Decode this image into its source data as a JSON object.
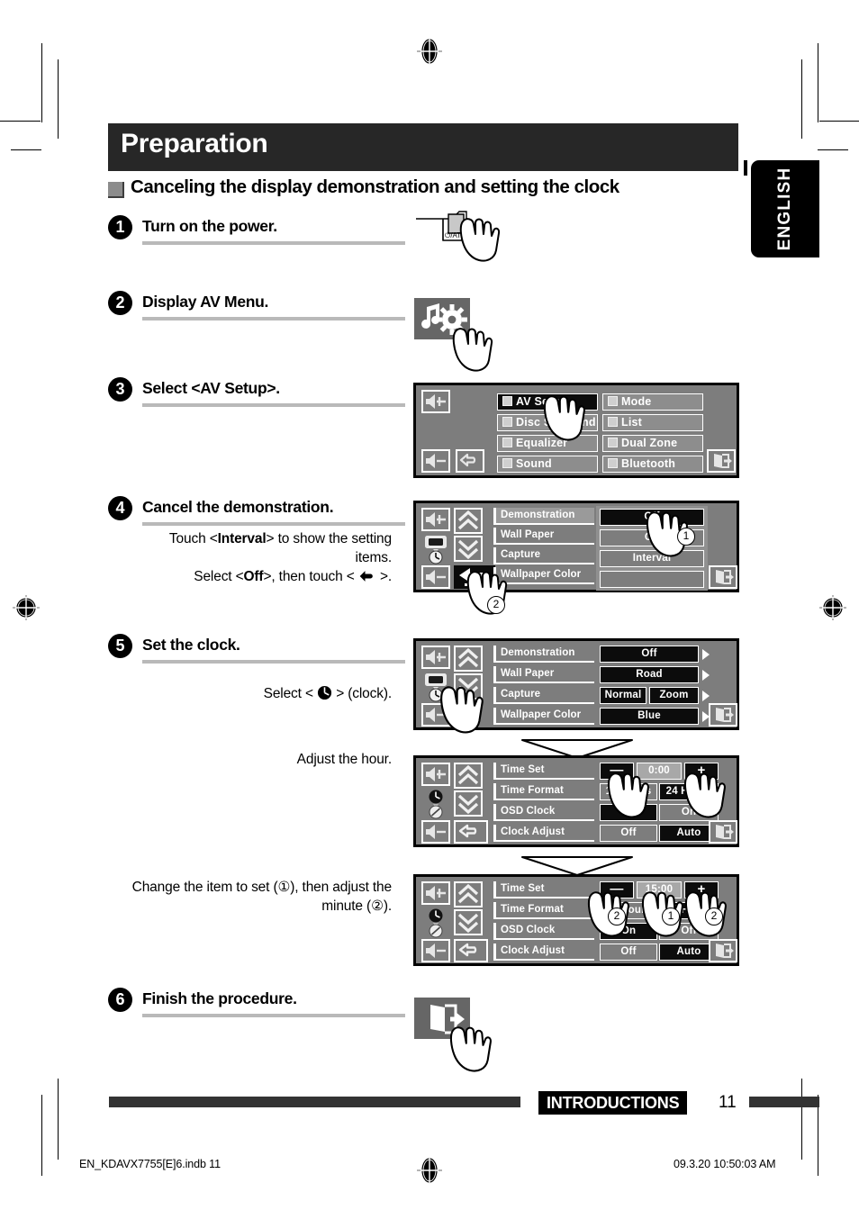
{
  "page": {
    "title": "Preparation",
    "section_heading": "Canceling the display demonstration and setting the clock",
    "language_tab": "ENGLISH",
    "footer_tag": "INTRODUCTIONS",
    "footer_page": "11",
    "colophon_left": "EN_KDAVX7755[E]6.indb   11",
    "colophon_right": "09.3.20   10:50:03 AM"
  },
  "steps": [
    {
      "num": "1",
      "title": "Turn on the power.",
      "sub": []
    },
    {
      "num": "2",
      "title": "Display AV Menu.",
      "sub": []
    },
    {
      "num": "3",
      "title": "Select <AV Setup>.",
      "sub": []
    },
    {
      "num": "4",
      "title": "Cancel the demonstration.",
      "sub": []
    },
    {
      "num": "5",
      "title": "Set the clock.",
      "sub": []
    },
    {
      "num": "6",
      "title": "Finish the procedure.",
      "sub": []
    }
  ],
  "instructions": {
    "step4_line1_pre": "Touch <",
    "step4_line1_bold": "Interval",
    "step4_line1_post": "> to show the setting",
    "step4_line2": "items.",
    "step4_line3_pre": "Select <",
    "step4_line3_bold": "Off",
    "step4_line3_post": ">, then touch < ",
    "step4_line3_end": " >.",
    "step5_select_pre": "Select < ",
    "step5_select_post": " > (clock).",
    "step5_adjust_hour": "Adjust the hour.",
    "step5_minute_line1": "Change the item to set (①), then adjust the",
    "step5_minute_line2": "minute (②)."
  },
  "av_setup_screen": {
    "left_column": [
      {
        "icon": "volume-up-icon"
      },
      {
        "icon": "back-arrow-icon"
      },
      {
        "icon": "volume-down-icon"
      }
    ],
    "menu_left": [
      {
        "label": "AV Setup",
        "icon": "av-setup-icon",
        "selected": true
      },
      {
        "label": "Disc Surround",
        "icon": "disc-surround-icon",
        "selected": false
      },
      {
        "label": "Equalizer",
        "icon": "equalizer-icon",
        "selected": false
      },
      {
        "label": "Sound",
        "icon": "sound-icon",
        "selected": false
      }
    ],
    "menu_right": [
      {
        "label": "Mode",
        "icon": "mode-icon",
        "selected": false
      },
      {
        "label": "List",
        "icon": "list-icon",
        "selected": false
      },
      {
        "label": "Dual Zone",
        "icon": "dual-zone-icon",
        "selected": false
      },
      {
        "label": "Bluetooth",
        "icon": "bluetooth-icon",
        "selected": false
      }
    ],
    "exit_icon": "exit-icon"
  },
  "demo_screen": {
    "rows": [
      {
        "label": "Demonstration",
        "value": "Off",
        "selected": true
      },
      {
        "label": "Wall Paper",
        "value": "On",
        "selected": false
      },
      {
        "label": "Capture",
        "value": "Interval",
        "selected": false
      },
      {
        "label": "Wallpaper Color",
        "value": "",
        "selected": false
      }
    ],
    "callouts": [
      "1",
      "2"
    ],
    "exit_icon": "exit-icon"
  },
  "display_screen": {
    "rows": [
      {
        "label": "Demonstration",
        "values": [
          "Off"
        ],
        "selected_index": -1
      },
      {
        "label": "Wall Paper",
        "values": [
          "Road"
        ],
        "selected_index": -1
      },
      {
        "label": "Capture",
        "values": [
          "Normal",
          "Zoom"
        ],
        "selected_index": -1
      },
      {
        "label": "Wallpaper Color",
        "values": [
          "Blue"
        ],
        "selected_index": -1
      }
    ],
    "exit_icon": "exit-icon"
  },
  "time_screen_hour": {
    "rows": [
      {
        "label": "Time Set",
        "minus": "—",
        "value": "0:00",
        "plus": "+"
      },
      {
        "label": "Time Format",
        "values": [
          "12 Hours",
          "24 Hours"
        ],
        "selected_index": 1
      },
      {
        "label": "OSD Clock",
        "values": [
          "Off",
          "On"
        ],
        "selected_index": 0
      },
      {
        "label": "Clock Adjust",
        "values": [
          "Off",
          "Auto"
        ],
        "selected_index": 1
      }
    ],
    "exit_icon": "exit-icon"
  },
  "time_screen_minute": {
    "rows": [
      {
        "label": "Time Set",
        "minus": "—",
        "value": "15:00",
        "plus": "+"
      },
      {
        "label": "Time Format",
        "values": [
          "12 Hours",
          "24 Hours"
        ],
        "selected_index": 1
      },
      {
        "label": "OSD Clock",
        "values": [
          "On",
          "Off"
        ],
        "selected_index": 0
      },
      {
        "label": "Clock Adjust",
        "values": [
          "Off",
          "Auto"
        ],
        "selected_index": 1
      }
    ],
    "callouts": [
      "2",
      "1",
      "2"
    ],
    "exit_icon": "exit-icon"
  },
  "power_button": {
    "label": "ATT",
    "symbol": "⏻"
  },
  "colors": {
    "screen_bg": "#7d7d7d",
    "selected": "#0c0c0c",
    "title_bar": "#272727",
    "rule": "#b9b9b9"
  }
}
